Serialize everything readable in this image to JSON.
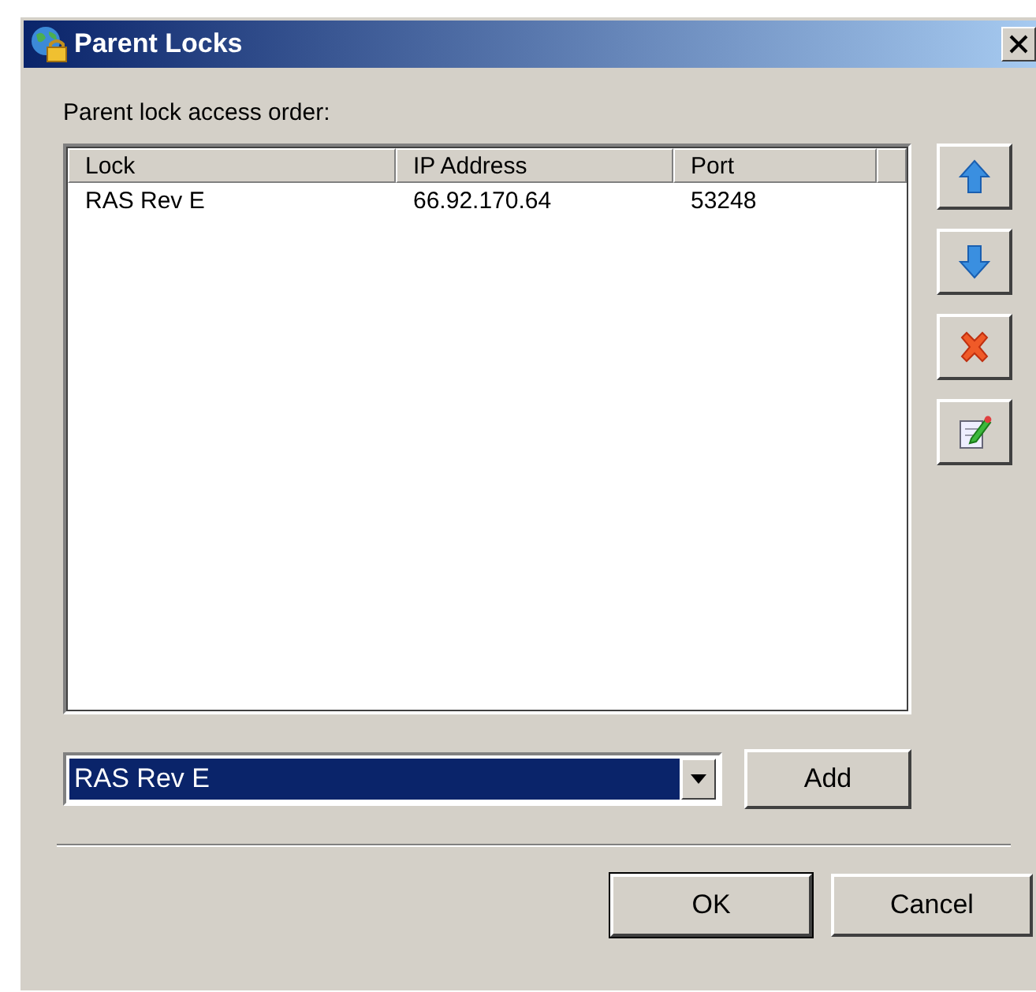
{
  "window": {
    "title": "Parent Locks"
  },
  "list_label": "Parent lock access order:",
  "table": {
    "columns": [
      "Lock",
      "IP Address",
      "Port"
    ],
    "rows": [
      [
        "RAS Rev E",
        "66.92.170.64",
        "53248"
      ]
    ]
  },
  "side_buttons": [
    {
      "kind": "up"
    },
    {
      "kind": "down"
    },
    {
      "kind": "delete"
    },
    {
      "kind": "edit"
    }
  ],
  "combo": {
    "value": "RAS Rev E"
  },
  "add_button": "Add",
  "buttons": [
    {
      "label": "OK",
      "default": true
    },
    {
      "label": "Cancel",
      "default": false
    }
  ]
}
